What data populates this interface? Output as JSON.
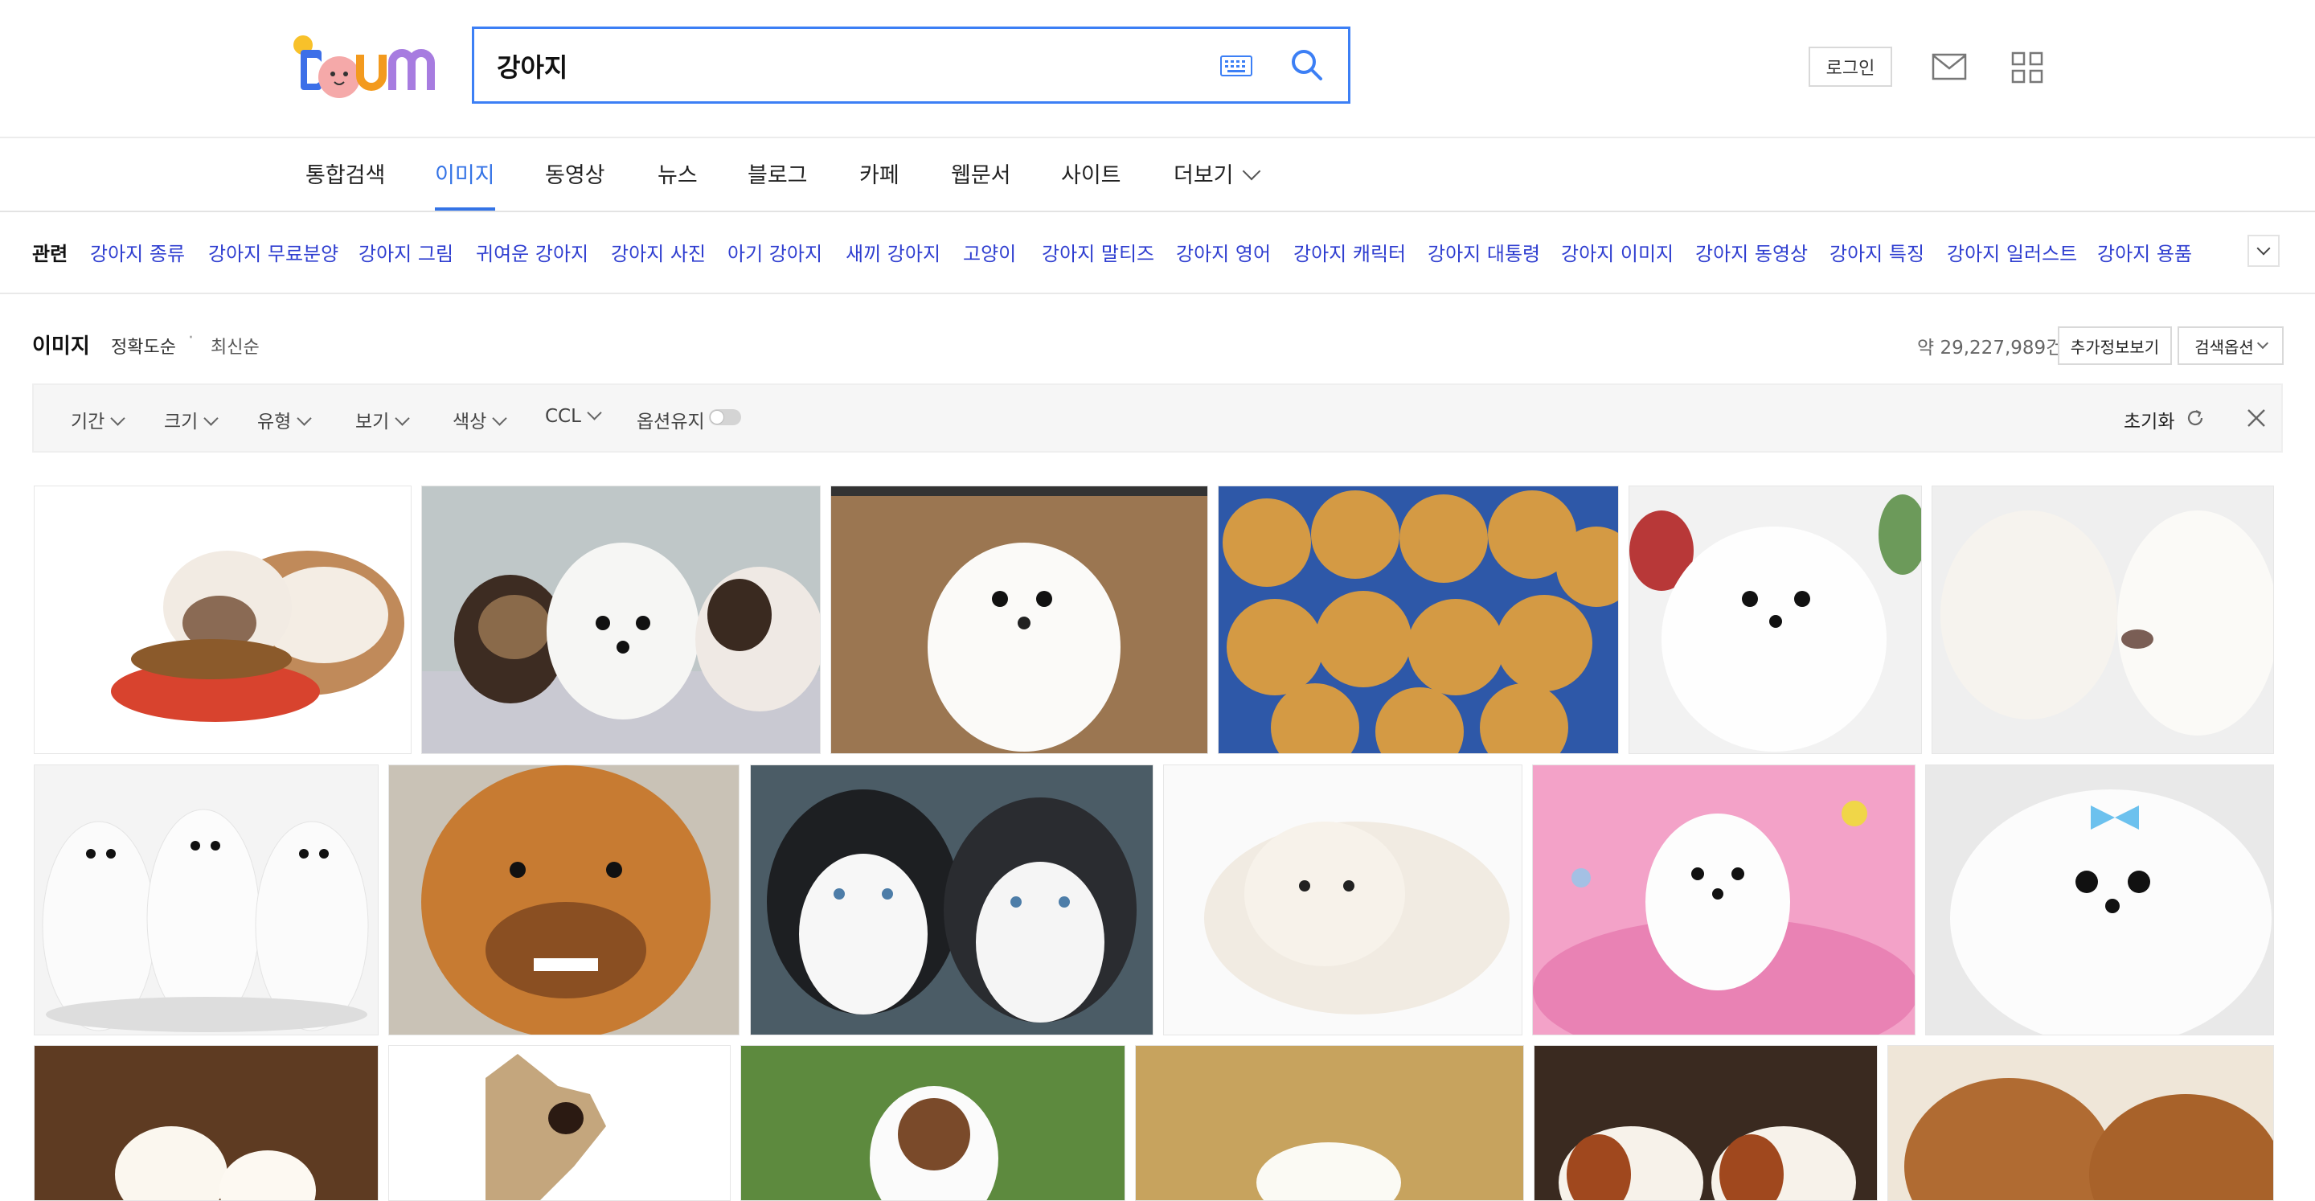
{
  "search": {
    "query": "강아지"
  },
  "header": {
    "login_label": "로그인"
  },
  "tabs": [
    {
      "label": "통합검색"
    },
    {
      "label": "이미지"
    },
    {
      "label": "동영상"
    },
    {
      "label": "뉴스"
    },
    {
      "label": "블로그"
    },
    {
      "label": "카페"
    },
    {
      "label": "웹문서"
    },
    {
      "label": "사이트"
    },
    {
      "label": "더보기"
    }
  ],
  "related": {
    "label": "관련",
    "items": [
      "강아지 종류",
      "강아지 무료분양",
      "강아지 그림",
      "귀여운 강아지",
      "강아지 사진",
      "아기 강아지",
      "새끼 강아지",
      "고양이",
      "강아지 말티즈",
      "강아지 영어",
      "강아지 캐릭터",
      "강아지 대통령",
      "강아지 이미지",
      "강아지 동영상",
      "강아지 특징",
      "강아지 일러스트",
      "강아지 용품"
    ]
  },
  "section": {
    "title": "이미지",
    "sort_accuracy": "정확도순",
    "sort_recent": "최신순",
    "count": "약 29,227,989건",
    "more_info_label": "추가정보보기",
    "search_option_label": "검색옵션"
  },
  "filters": {
    "period": "기간",
    "size": "크기",
    "type": "유형",
    "view": "보기",
    "color": "색상",
    "ccl": "CCL",
    "keep_option": "옵션유지",
    "reset": "초기화"
  },
  "colors": {
    "accent": "#3473e6",
    "related_link": "#2f3ed0",
    "search_border": "#3c7ff5"
  }
}
